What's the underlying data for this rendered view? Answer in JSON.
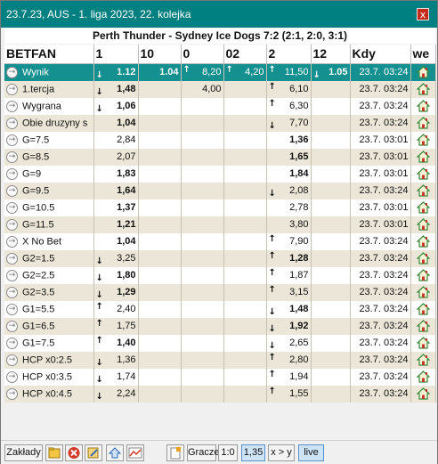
{
  "window": {
    "title": "23.7.23, AUS - 1. liga 2023, 22. kolejka",
    "close_label": "x"
  },
  "match": {
    "title": "Perth Thunder - Sydney Ice Dogs 7:2 (2:1, 2:0, 3:1)"
  },
  "columns": [
    "BETFAN",
    "1",
    "10",
    "0",
    "02",
    "2",
    "12",
    "Kdy",
    "we"
  ],
  "rows": [
    {
      "name": "Wynik",
      "c1": "1.12",
      "c1_arrow": "down",
      "c10": "1.04",
      "c0": "8,20",
      "c0_arrow": "up",
      "c02": "4,20",
      "c02_arrow": "up",
      "c2": "11,50",
      "c2_arrow": "up",
      "c12": "1.05",
      "c12_arrow": "down",
      "time": "23.7. 03:24",
      "selected": true
    },
    {
      "name": "1.tercja",
      "c1": "1,48",
      "c1_arrow": "down",
      "c0": "4,00",
      "c2": "6,10",
      "c2_arrow": "up",
      "time": "23.7. 03:24"
    },
    {
      "name": "Wygrana",
      "c1": "1,06",
      "c1_arrow": "down",
      "c2": "6,30",
      "c2_arrow": "up",
      "time": "23.7. 03:24"
    },
    {
      "name": "Obie druzyny s",
      "c1": "1,04",
      "c2": "7,70",
      "c2_arrow": "down",
      "time": "23.7. 03:24"
    },
    {
      "name": "G=7.5",
      "c1": "2,84",
      "c2": "1,36",
      "time": "23.7. 03:01"
    },
    {
      "name": "G=8.5",
      "c1": "2,07",
      "c2": "1,65",
      "time": "23.7. 03:01"
    },
    {
      "name": "G=9",
      "c1": "1,83",
      "c2": "1,84",
      "time": "23.7. 03:01"
    },
    {
      "name": "G=9.5",
      "c1": "1,64",
      "c2": "2,08",
      "c2_arrow": "down",
      "time": "23.7. 03:24"
    },
    {
      "name": "G=10.5",
      "c1": "1,37",
      "c2": "2,78",
      "time": "23.7. 03:01"
    },
    {
      "name": "G=11.5",
      "c1": "1,21",
      "c2": "3,80",
      "time": "23.7. 03:01"
    },
    {
      "name": "X No Bet",
      "c1": "1,04",
      "c2": "7,90",
      "c2_arrow": "up",
      "time": "23.7. 03:24"
    },
    {
      "name": "G2=1.5",
      "c1": "3,25",
      "c1_arrow": "down",
      "c2": "1,28",
      "c2_arrow": "up",
      "time": "23.7. 03:24"
    },
    {
      "name": "G2=2.5",
      "c1": "1,80",
      "c1_arrow": "down",
      "c2": "1,87",
      "c2_arrow": "up",
      "time": "23.7. 03:24"
    },
    {
      "name": "G2=3.5",
      "c1": "1,29",
      "c1_arrow": "down",
      "c2": "3,15",
      "c2_arrow": "up",
      "time": "23.7. 03:24"
    },
    {
      "name": "G1=5.5",
      "c1": "2,40",
      "c1_arrow": "up",
      "c2": "1,48",
      "c2_arrow": "down",
      "time": "23.7. 03:24"
    },
    {
      "name": "G1=6.5",
      "c1": "1,75",
      "c1_arrow": "up",
      "c2": "1,92",
      "c2_arrow": "down",
      "time": "23.7. 03:24"
    },
    {
      "name": "G1=7.5",
      "c1": "1,40",
      "c1_arrow": "up",
      "c2": "2,65",
      "c2_arrow": "down",
      "time": "23.7. 03:24"
    },
    {
      "name": "HCP x0:2.5",
      "c1": "1,36",
      "c1_arrow": "down",
      "c2": "2,80",
      "c2_arrow": "up",
      "time": "23.7. 03:24"
    },
    {
      "name": "HCP x0:3.5",
      "c1": "1,74",
      "c1_arrow": "down",
      "c2": "1,94",
      "c2_arrow": "up",
      "time": "23.7. 03:24"
    },
    {
      "name": "HCP x0:4.5",
      "c1": "2,24",
      "c1_arrow": "down",
      "c2": "1,55",
      "c2_arrow": "up",
      "time": "23.7. 03:24"
    }
  ],
  "bold_c1": [
    "Wynik",
    "1.tercja",
    "Wygrana",
    "Obie druzyny s",
    "G=9",
    "G=9.5",
    "G=10.5",
    "G=11.5",
    "X No Bet",
    "G2=2.5",
    "G2=3.5",
    "G1=7.5"
  ],
  "bold_c2": [
    "G=7.5",
    "G=8.5",
    "G=9",
    "G2=1.5",
    "G1=5.5",
    "G1=6.5"
  ],
  "toolbar": {
    "zaklady_label": "Zakłady",
    "gracze_label": "Gracze",
    "score_label": "1:0",
    "odds_label": "1,35",
    "xy_label": "x > y",
    "live_label": "live"
  },
  "icons": {
    "row_icon": "arrow-circle-icon",
    "home_icon": "home-icon"
  },
  "colors": {
    "titlebar": "#008080",
    "selected_row": "#159090",
    "alt_row": "#ebe6d7"
  }
}
